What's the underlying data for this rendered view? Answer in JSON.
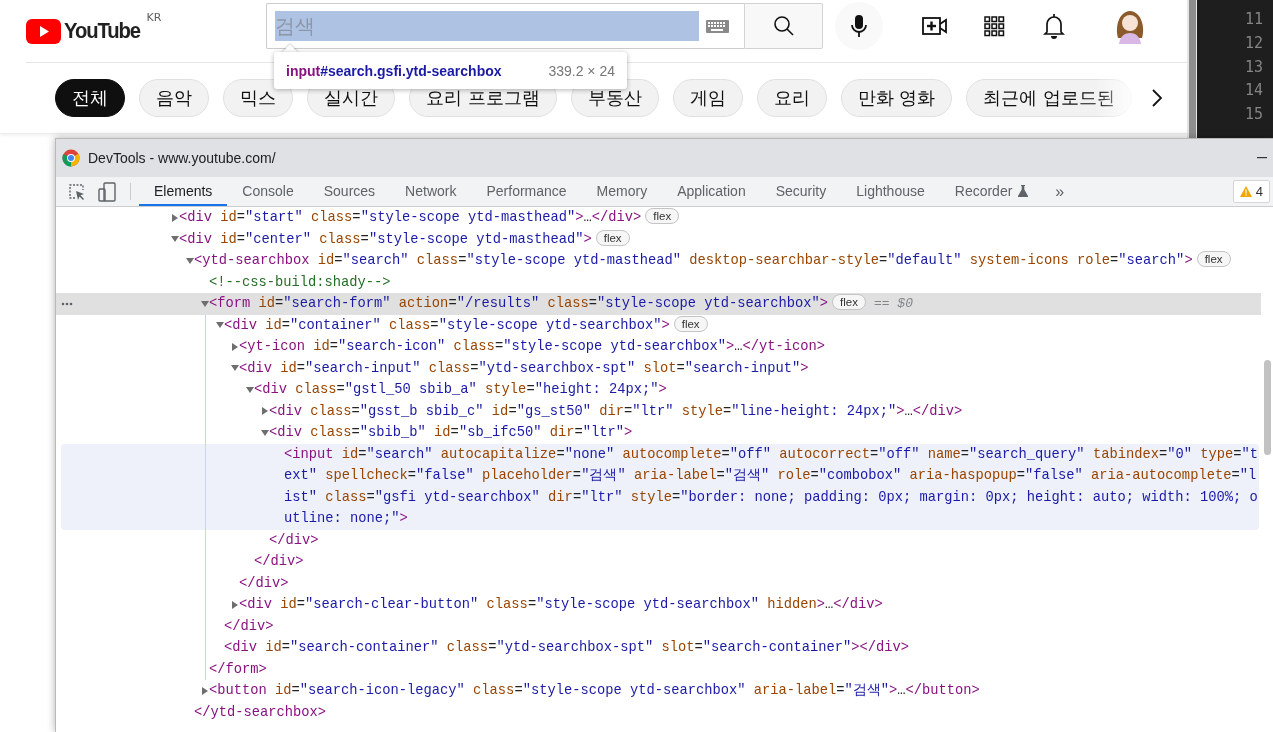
{
  "masthead": {
    "logo": "YouTube",
    "country_code": "KR",
    "search": {
      "placeholder": "검색",
      "inspected": true
    }
  },
  "inspect_tooltip": {
    "tag": "input",
    "selector": "#search.gsfi.ytd-searchbox",
    "size": "339.2 × 24"
  },
  "chips": [
    {
      "label": "전체",
      "selected": true
    },
    {
      "label": "음악",
      "selected": false
    },
    {
      "label": "믹스",
      "selected": false
    },
    {
      "label": "실시간",
      "selected": false
    },
    {
      "label": "요리 프로그램",
      "selected": false
    },
    {
      "label": "부동산",
      "selected": false
    },
    {
      "label": "게임",
      "selected": false
    },
    {
      "label": "요리",
      "selected": false
    },
    {
      "label": "만화 영화",
      "selected": false
    },
    {
      "label": "최근에 업로드된",
      "selected": false
    }
  ],
  "editor_gutter": {
    "line_numbers": [
      "11",
      "12",
      "13",
      "14",
      "15"
    ]
  },
  "devtools": {
    "title": "DevTools - www.youtube.com/",
    "tabs": [
      {
        "label": "Elements",
        "selected": true,
        "kind": "plain"
      },
      {
        "label": "Console",
        "selected": false,
        "kind": "plain"
      },
      {
        "label": "Sources",
        "selected": false,
        "kind": "plain"
      },
      {
        "label": "Network",
        "selected": false,
        "kind": "plain"
      },
      {
        "label": "Performance",
        "selected": false,
        "kind": "plain"
      },
      {
        "label": "Memory",
        "selected": false,
        "kind": "plain"
      },
      {
        "label": "Application",
        "selected": false,
        "kind": "plain"
      },
      {
        "label": "Security",
        "selected": false,
        "kind": "plain"
      },
      {
        "label": "Lighthouse",
        "selected": false,
        "kind": "plain"
      },
      {
        "label": "Recorder",
        "selected": false,
        "kind": "experimental"
      }
    ],
    "more_tabs": "»",
    "warnings": "4",
    "tree": [
      {
        "kind": "node",
        "open": "<div id=\"start\" class=\"style-scope ytd-masthead\">…</div>",
        "badge": "flex",
        "expanded": false,
        "selected": false,
        "hovered": false
      },
      {
        "kind": "node",
        "open": "<div id=\"center\" class=\"style-scope ytd-masthead\">",
        "badge": "flex",
        "expanded": true,
        "selected": false,
        "hovered": false,
        "children": [
          {
            "kind": "node",
            "open": "<ytd-searchbox id=\"search\" class=\"style-scope ytd-masthead\" desktop-searchbar-style=\"default\" system-icons role=\"search\">",
            "badge": "flex",
            "expanded": true,
            "selected": false,
            "hovered": false,
            "close": "</ytd-searchbox>",
            "children": [
              {
                "kind": "leaf",
                "open": "<!--css-build:shady-->",
                "selected": false,
                "hovered": false
              },
              {
                "kind": "node",
                "open": "<form id=\"search-form\" action=\"/results\" class=\"style-scope ytd-searchbox\">",
                "badge": "flex",
                "console_ref": "== $0",
                "expanded": true,
                "selected": true,
                "hovered": false,
                "close": "</form>",
                "children": [
                  {
                    "kind": "node",
                    "open": "<div id=\"container\" class=\"style-scope ytd-searchbox\">",
                    "badge": "flex",
                    "expanded": true,
                    "selected": false,
                    "hovered": false,
                    "close": "</div>",
                    "children": [
                      {
                        "kind": "node",
                        "open": "<yt-icon id=\"search-icon\" class=\"style-scope ytd-searchbox\">…</yt-icon>",
                        "expanded": false,
                        "selected": false,
                        "hovered": false
                      },
                      {
                        "kind": "node",
                        "open": "<div id=\"search-input\" class=\"ytd-searchbox-spt\" slot=\"search-input\">",
                        "expanded": true,
                        "selected": false,
                        "hovered": false,
                        "close": "</div>",
                        "children": [
                          {
                            "kind": "node",
                            "open": "<div class=\"gstl_50 sbib_a\" style=\"height: 24px;\">",
                            "expanded": true,
                            "selected": false,
                            "hovered": false,
                            "close": "</div>",
                            "children": [
                              {
                                "kind": "node",
                                "open": "<div class=\"gsst_b sbib_c\" id=\"gs_st50\" dir=\"ltr\" style=\"line-height: 24px;\">…</div>",
                                "expanded": false,
                                "selected": false,
                                "hovered": false
                              },
                              {
                                "kind": "node",
                                "open": "<div class=\"sbib_b\" id=\"sb_ifc50\" dir=\"ltr\">",
                                "expanded": true,
                                "selected": false,
                                "hovered": false,
                                "close": "</div>",
                                "children": [
                                  {
                                    "kind": "leaf",
                                    "open": "<input id=\"search\" autocapitalize=\"none\" autocomplete=\"off\" autocorrect=\"off\" name=\"search_query\" tabindex=\"0\" type=\"text\" spellcheck=\"false\" placeholder=\"검색\" aria-label=\"검색\" role=\"combobox\" aria-haspopup=\"false\" aria-autocomplete=\"list\" class=\"gsfi ytd-searchbox\" dir=\"ltr\" style=\"border: none; padding: 0px; margin: 0px; height: auto; width: 100%; outline: none;\">",
                                    "selected": false,
                                    "hovered": true
                                  }
                                ]
                              }
                            ]
                          }
                        ]
                      },
                      {
                        "kind": "node",
                        "open": "<div id=\"search-clear-button\" class=\"style-scope ytd-searchbox\" hidden>…</div>",
                        "expanded": false,
                        "selected": false,
                        "hovered": false
                      }
                    ]
                  },
                  {
                    "kind": "leaf",
                    "open": "<div id=\"search-container\" class=\"ytd-searchbox-spt\" slot=\"search-container\"></div>",
                    "selected": false,
                    "hovered": false
                  }
                ]
              },
              {
                "kind": "node",
                "open": "<button id=\"search-icon-legacy\" class=\"style-scope ytd-searchbox\" aria-label=\"검색\">…</button>",
                "expanded": false,
                "selected": false,
                "hovered": false
              }
            ]
          }
        ]
      }
    ]
  }
}
